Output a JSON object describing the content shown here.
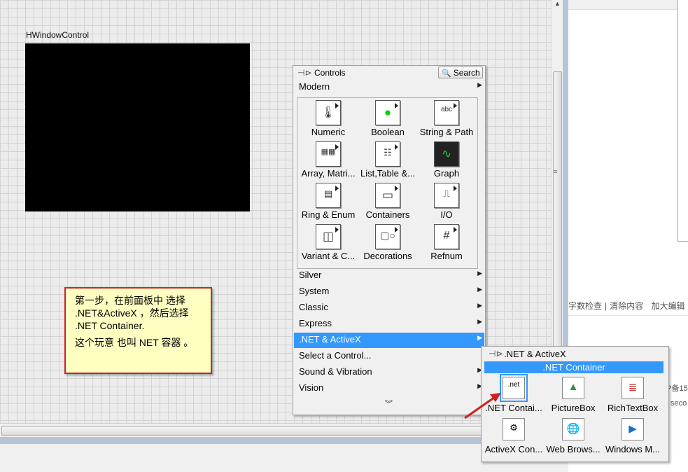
{
  "front_panel": {
    "control_label": "HWindowControl"
  },
  "note": {
    "line1": "第一步，在前面板中 选择 .NET&ActiveX ，然后选择 .NET Container.",
    "line2": "这个玩意 也叫 NET 容器 。"
  },
  "palette": {
    "title": "Controls",
    "search_label": "Search",
    "categories": [
      {
        "label": "Modern"
      },
      {
        "label": "Silver"
      },
      {
        "label": "System"
      },
      {
        "label": "Classic"
      },
      {
        "label": "Express"
      },
      {
        "label": ".NET & ActiveX"
      },
      {
        "label": "Select a Control..."
      },
      {
        "label": "Sound & Vibration"
      },
      {
        "label": "Vision"
      }
    ],
    "modern_items": [
      {
        "label": "Numeric",
        "icon": "numeric-icon"
      },
      {
        "label": "Boolean",
        "icon": "boolean-icon"
      },
      {
        "label": "String & Path",
        "icon": "string-path-icon"
      },
      {
        "label": "Array, Matri...",
        "icon": "array-matrix-icon"
      },
      {
        "label": "List,Table &...",
        "icon": "list-table-icon"
      },
      {
        "label": "Graph",
        "icon": "graph-icon"
      },
      {
        "label": "Ring & Enum",
        "icon": "ring-enum-icon"
      },
      {
        "label": "Containers",
        "icon": "containers-icon"
      },
      {
        "label": "I/O",
        "icon": "io-icon"
      },
      {
        "label": "Variant & C...",
        "icon": "variant-class-icon"
      },
      {
        "label": "Decorations",
        "icon": "decorations-icon"
      },
      {
        "label": "Refnum",
        "icon": "refnum-icon"
      }
    ]
  },
  "subpalette": {
    "title": ".NET & ActiveX",
    "selected_label": ".NET Container",
    "items": [
      {
        "label": ".NET Contai...",
        "icon": "net-container-icon"
      },
      {
        "label": "PictureBox",
        "icon": "picturebox-icon"
      },
      {
        "label": "RichTextBox",
        "icon": "richtextbox-icon"
      },
      {
        "label": "ActiveX Con...",
        "icon": "activex-container-icon"
      },
      {
        "label": "Web Brows...",
        "icon": "web-browser-icon"
      },
      {
        "label": "Windows M...",
        "icon": "windows-media-icon"
      }
    ]
  },
  "background": {
    "toolbar_items": [
      "字数检查",
      "清除内容",
      "加大编辑"
    ],
    "text1": "P备15",
    "text2": "seco"
  },
  "colors": {
    "highlight": "#3399ff",
    "note_bg": "#ffffc2",
    "note_border": "#c8262a",
    "arrow": "#d21e1e"
  }
}
